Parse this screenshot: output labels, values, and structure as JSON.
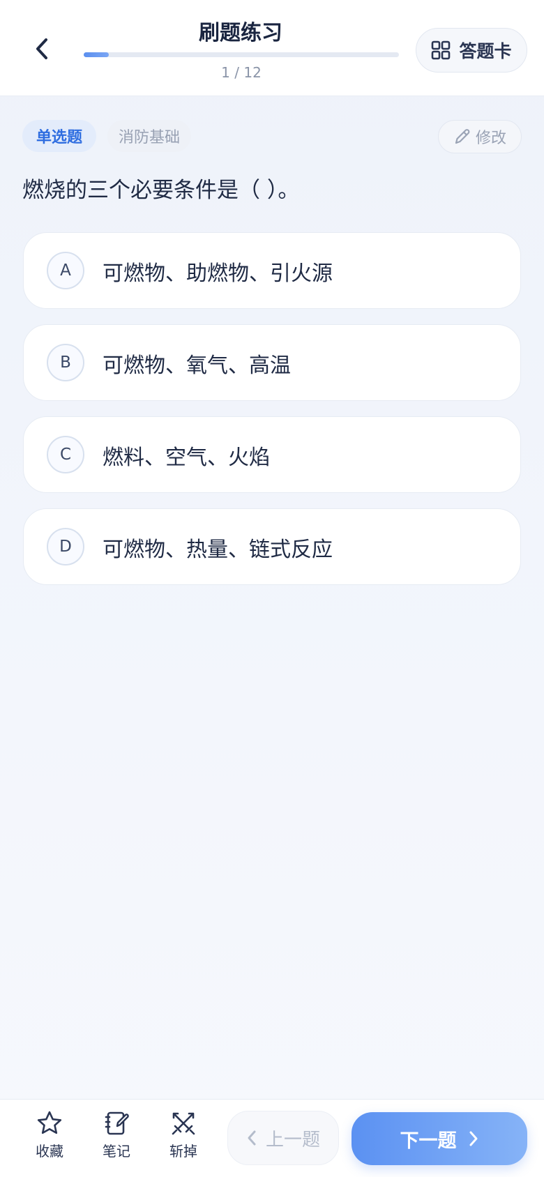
{
  "header": {
    "title": "刷题练习",
    "progress_text": "1 / 12",
    "progress_fraction": 0.08,
    "answer_card_label": "答题卡"
  },
  "question": {
    "type_tag": "单选题",
    "category_tag": "消防基础",
    "edit_label": "修改",
    "text": "燃烧的三个必要条件是（ ）。",
    "options": [
      {
        "letter": "A",
        "text": "可燃物、助燃物、引火源"
      },
      {
        "letter": "B",
        "text": "可燃物、氧气、高温"
      },
      {
        "letter": "C",
        "text": "燃料、空气、火焰"
      },
      {
        "letter": "D",
        "text": "可燃物、热量、链式反应"
      }
    ]
  },
  "bottom_bar": {
    "favorite_label": "收藏",
    "notes_label": "笔记",
    "remove_label": "斩掉",
    "prev_label": "上一题",
    "next_label": "下一题"
  },
  "colors": {
    "accent": "#5b91f2",
    "tag_blue": "#2e6de0"
  },
  "icons": [
    "back-arrow-icon",
    "grid-icon",
    "pencil-icon",
    "star-icon",
    "notebook-icon",
    "crossed-swords-icon",
    "chevron-left-icon",
    "chevron-right-icon"
  ]
}
